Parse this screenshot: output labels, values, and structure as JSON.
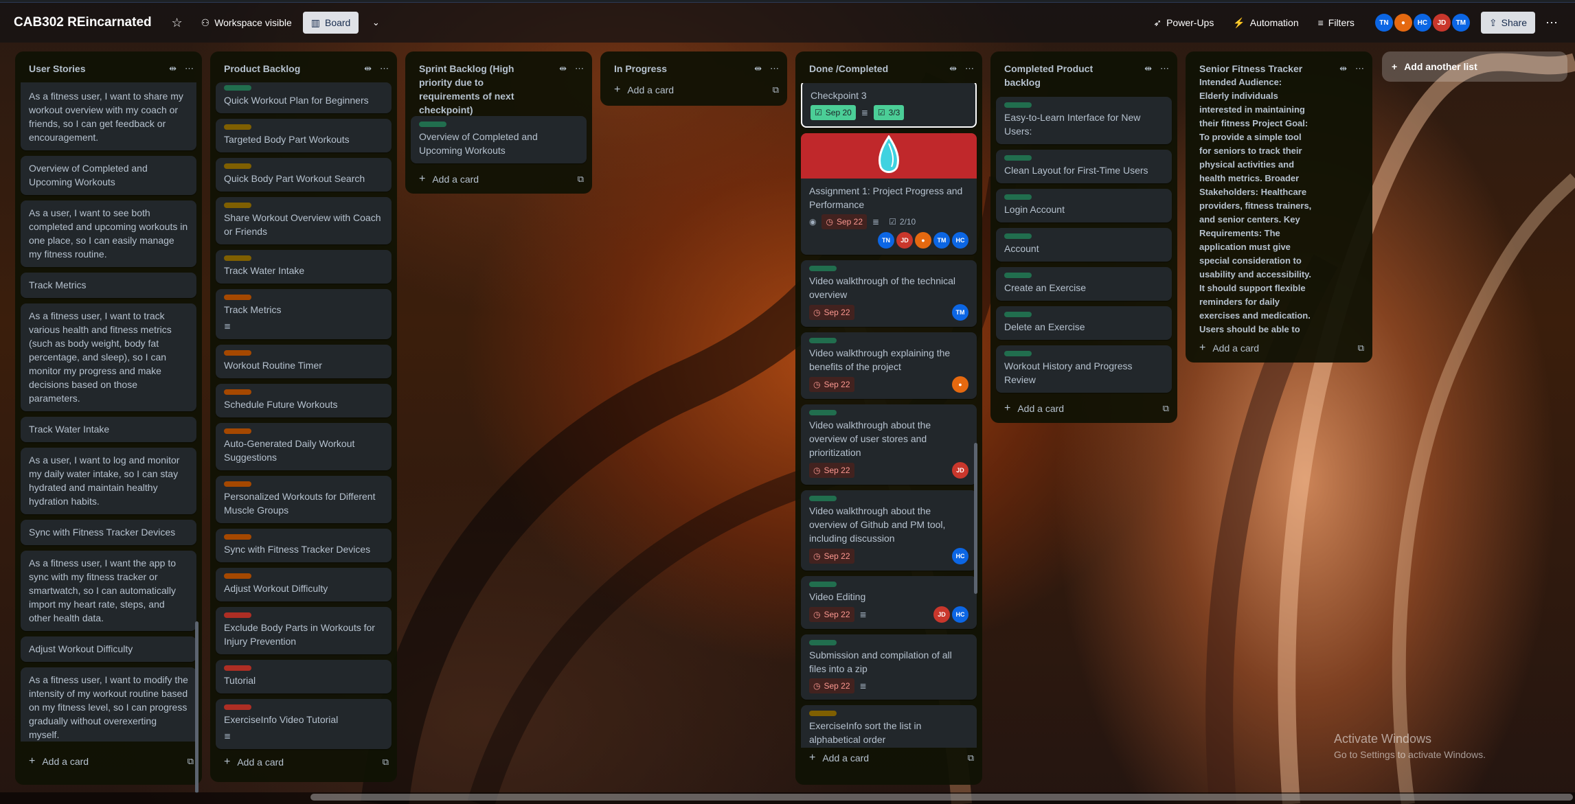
{
  "header": {
    "board_title": "CAB302 REincarnated",
    "visibility": "Workspace visible",
    "view": "Board",
    "powerups": "Power-Ups",
    "automation": "Automation",
    "filters": "Filters",
    "share": "Share",
    "members": [
      {
        "initials": "TN",
        "color": "#0c66e4"
      },
      {
        "initials": "",
        "color": "#e56910"
      },
      {
        "initials": "HC",
        "color": "#0c66e4"
      },
      {
        "initials": "JD",
        "color": "#c9372c"
      },
      {
        "initials": "TM",
        "color": "#0c66e4"
      }
    ]
  },
  "lists": {
    "user_stories": {
      "title": "User Stories",
      "cards": [
        "As a fitness user, I want to share my workout overview with my coach or friends, so I can get feedback or encouragement.",
        "Overview of Completed and Upcoming Workouts",
        "As a user, I want to see both completed and upcoming workouts in one place, so I can easily manage my fitness routine.",
        "Track Metrics",
        "As a fitness user, I want to track various health and fitness metrics (such as body weight, body fat percentage, and sleep), so I can monitor my progress and make decisions based on those parameters.",
        "Track Water Intake",
        "As a user, I want to log and monitor my daily water intake, so I can stay hydrated and maintain healthy hydration habits.",
        "Sync with Fitness Tracker Devices",
        "As a fitness user, I want the app to sync with my fitness tracker or smartwatch, so I can automatically import my heart rate, steps, and other health data.",
        "Adjust Workout Difficulty",
        "As a fitness user, I want to modify the intensity of my workout routine based on my fitness level, so I can progress gradually without overexerting myself."
      ],
      "add": "Add a card"
    },
    "product_backlog": {
      "title": "Product Backlog",
      "cards": [
        {
          "label": "green",
          "text": "Quick Workout Plan for Beginners"
        },
        {
          "label": "yellow",
          "text": "Targeted Body Part Workouts"
        },
        {
          "label": "yellow",
          "text": "Quick Body Part Workout Search"
        },
        {
          "label": "yellow",
          "text": "Share Workout Overview with Coach or Friends"
        },
        {
          "label": "yellow",
          "text": "Track Water Intake"
        },
        {
          "label": "orange",
          "text": "Track Metrics",
          "desc": true
        },
        {
          "label": "orange",
          "text": "Workout Routine Timer"
        },
        {
          "label": "orange",
          "text": "Schedule Future Workouts"
        },
        {
          "label": "orange",
          "text": "Auto-Generated Daily Workout Suggestions"
        },
        {
          "label": "orange",
          "text": "Personalized Workouts for Different Muscle Groups"
        },
        {
          "label": "orange",
          "text": "Sync with Fitness Tracker Devices"
        },
        {
          "label": "orange",
          "text": "Adjust Workout Difficulty"
        },
        {
          "label": "red",
          "text": "Exclude Body Parts in Workouts for Injury Prevention"
        },
        {
          "label": "red",
          "text": "Tutorial"
        },
        {
          "label": "red",
          "text": "ExerciseInfo Video Tutorial",
          "desc": true
        }
      ],
      "add": "Add a card"
    },
    "sprint_backlog": {
      "title": "Sprint Backlog (High priority due to requirements of next checkpoint)",
      "cards": [
        {
          "label": "green",
          "text": "Overview of Completed and Upcoming Workouts"
        }
      ],
      "add": "Add a card"
    },
    "in_progress": {
      "title": "In Progress",
      "add": "Add a card"
    },
    "done": {
      "title": "Done /Completed",
      "cards": {
        "c1": {
          "text": "Checkpoint 3",
          "due": "Sep 20",
          "check": "3/3"
        },
        "c2": {
          "text": "Assignment 1: Project Progress and Performance",
          "due": "Sep 22",
          "check": "2/10"
        },
        "c3": {
          "text": "Video walkthrough of the technical overview",
          "due": "Sep 22",
          "member": "TM"
        },
        "c4": {
          "text": "Video walkthrough explaining the benefits of the project",
          "due": "Sep 22"
        },
        "c5": {
          "text": "Video walkthrough about the overview of user stores and prioritization",
          "due": "Sep 22",
          "member": "JD"
        },
        "c6": {
          "text": "Video walkthrough about the overview of Github and PM tool, including discussion",
          "due": "Sep 22",
          "member": "HC"
        },
        "c7": {
          "text": "Video Editing",
          "due": "Sep 22",
          "m1": "JD",
          "m2": "HC"
        },
        "c8": {
          "text": "Submission and compilation of all files into a zip",
          "due": "Sep 22"
        },
        "c9": {
          "text": "ExerciseInfo sort the list in alphabetical order"
        }
      },
      "c2_members": [
        "TN",
        "JD",
        "",
        "TM",
        "HC"
      ],
      "add": "Add a card"
    },
    "completed_product_backlog": {
      "title": "Completed Product backlog",
      "cards": [
        "Easy-to-Learn Interface for New Users:",
        "Clean Layout for First-Time Users",
        "Login Account",
        "Account",
        "Create an Exercise",
        "Delete an Exercise",
        "Workout History and Progress Review"
      ],
      "add": "Add a card"
    },
    "senior": {
      "title": "Senior Fitness Tracker",
      "body": "Intended Audience: Elderly individuals interested in maintaining their fitness Project Goal: To provide a simple tool for seniors to track their physical activities and health metrics. Broader Stakeholders: Healthcare providers, fitness trainers, and senior centers. Key Requirements: The application must give special consideration to usability and accessibility. It should support flexible reminders for daily exercises and medication. Users should be able to log their activities and m",
      "add": "Add a card"
    }
  },
  "add_another_list": "Add another list",
  "watermark": {
    "title": "Activate Windows",
    "subtitle": "Go to Settings to activate Windows."
  },
  "colors": {
    "list_bg": "#101204",
    "card_bg": "#22272b",
    "green_label": "#216e4e",
    "yellow_label": "#7f5f01",
    "orange_label": "#a54800",
    "red_label": "#ae2e24"
  }
}
